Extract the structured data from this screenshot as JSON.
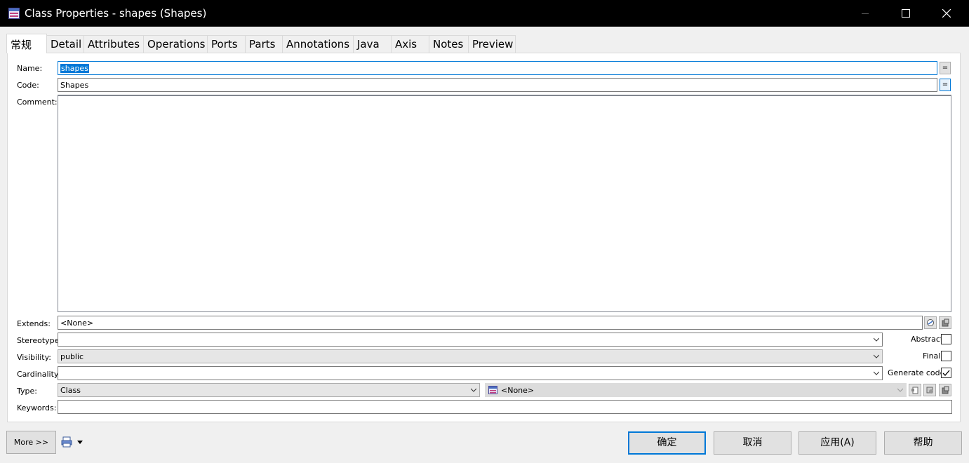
{
  "window": {
    "title": "Class Properties - shapes (Shapes)",
    "icons": {
      "app": "class-icon",
      "minimize": "minimize-icon",
      "maximize": "maximize-icon",
      "close": "close-icon"
    }
  },
  "tabs": [
    {
      "label": "常规",
      "active": true
    },
    {
      "label": "Detail"
    },
    {
      "label": "Attributes"
    },
    {
      "label": "Operations"
    },
    {
      "label": "Ports"
    },
    {
      "label": "Parts"
    },
    {
      "label": "Annotations"
    },
    {
      "label": "Java"
    },
    {
      "label": "Axis"
    },
    {
      "label": "Notes"
    },
    {
      "label": "Preview"
    }
  ],
  "form": {
    "name_label": "Name:",
    "name_value": "shapes",
    "code_label": "Code:",
    "code_value": "Shapes",
    "eq_label": "=",
    "comment_label": "Comment:",
    "comment_value": "",
    "extends_label": "Extends:",
    "extends_value": "<None>",
    "stereotype_label": "Stereotype:",
    "stereotype_value": "",
    "visibility_label": "Visibility:",
    "visibility_value": "public",
    "cardinality_label": "Cardinality:",
    "cardinality_value": "",
    "type_label": "Type:",
    "type_value": "Class",
    "type_ref_value": "<None>",
    "keywords_label": "Keywords:",
    "keywords_value": "",
    "abstract_label": "Abstract",
    "abstract_checked": false,
    "final_label": "Final",
    "final_checked": false,
    "generate_code_label": "Generate code",
    "generate_code_checked": true
  },
  "footer": {
    "more_label": "More >>",
    "ok_label": "确定",
    "cancel_label": "取消",
    "apply_label": "应用(A)",
    "help_label": "帮助"
  },
  "colors": {
    "titlebar_bg": "#000000",
    "accent": "#0078d7",
    "window_bg": "#f0f0f0"
  }
}
